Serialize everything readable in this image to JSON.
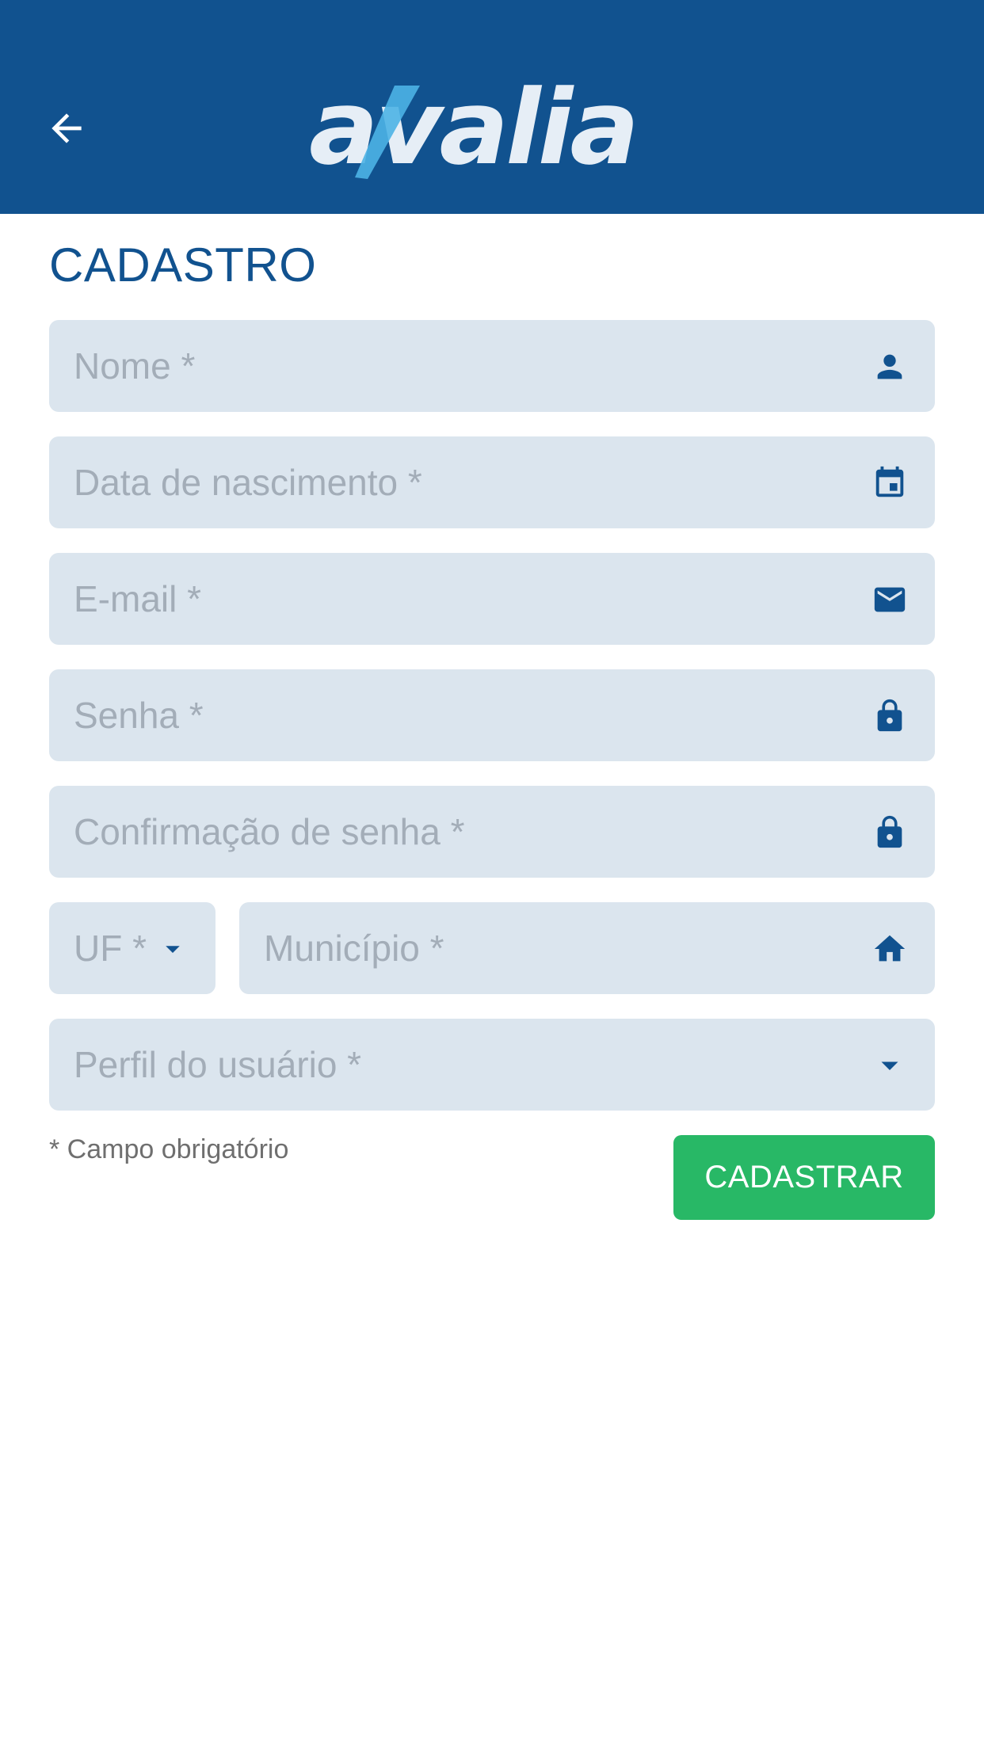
{
  "header": {
    "back_icon": "arrow-back-icon",
    "logo_text": "avalia",
    "background_color": "#11528f"
  },
  "page": {
    "title": "CADASTRO"
  },
  "form": {
    "fields": {
      "name": {
        "placeholder": "Nome *",
        "icon": "person-icon"
      },
      "birthdate": {
        "placeholder": "Data de nascimento *",
        "icon": "calendar-icon"
      },
      "email": {
        "placeholder": "E-mail *",
        "icon": "mail-icon"
      },
      "password": {
        "placeholder": "Senha *",
        "icon": "lock-icon"
      },
      "password_confirm": {
        "placeholder": "Confirmação de senha *",
        "icon": "lock-icon"
      },
      "uf": {
        "placeholder": "UF *",
        "icon": "dropdown-caret-icon"
      },
      "municipality": {
        "placeholder": "Município *",
        "icon": "home-icon"
      },
      "profile": {
        "placeholder": "Perfil do usuário *",
        "icon": "dropdown-caret-icon"
      }
    },
    "required_hint": "* Campo obrigatório",
    "submit_label": "CADASTRAR"
  },
  "colors": {
    "primary": "#11528f",
    "field_bg": "#dbe5ee",
    "placeholder": "#a3adb8",
    "submit": "#28b866",
    "logo_accent": "#4db3e6"
  }
}
